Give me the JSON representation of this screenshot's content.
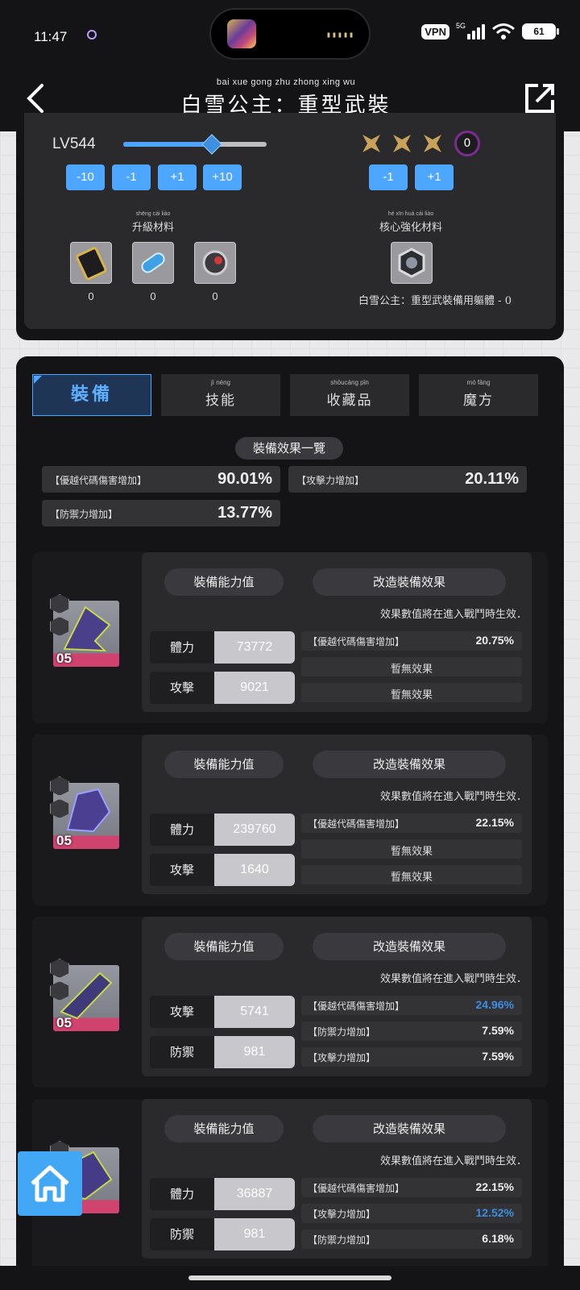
{
  "status": {
    "time": "11:47",
    "vpn": "VPN",
    "network": "5G",
    "battery": "61"
  },
  "header": {
    "title": "白雪公主：重型武裝",
    "ruby": "bai xue gong zhu      zhong xing wu"
  },
  "upgrade": {
    "level": "LV544",
    "level_fill": 0.62,
    "level_buttons": [
      "-10",
      "-1",
      "+1",
      "+10"
    ],
    "stars": 3,
    "star_count": "0",
    "core_buttons": [
      "-1",
      "+1"
    ],
    "materials_label": "升級材料",
    "materials_ruby": "shēng   cái  liào",
    "materials": [
      {
        "icon": "gold-battery-icon",
        "count": "0"
      },
      {
        "icon": "blue-capsule-icon",
        "count": "0"
      },
      {
        "icon": "red-core-orb-icon",
        "count": "0"
      }
    ],
    "core_label": "核心強化材料",
    "core_ruby": "hé  xīn     huà  cái  liào",
    "core_material": {
      "icon": "hexagon-module-icon"
    },
    "core_caption": "白雪公主：重型武裝備用軀體 - 0"
  },
  "tabs": [
    {
      "label": "裝備",
      "ruby": "",
      "active": true
    },
    {
      "label": "技能",
      "ruby": "jì  néng"
    },
    {
      "label": "收藏品",
      "ruby": "shōucáng pǐn"
    },
    {
      "label": "魔方",
      "ruby": "mó fāng"
    }
  ],
  "summary": {
    "title": "裝備效果一覽",
    "items": [
      {
        "label": "【優越代碼傷害增加】",
        "value": "90.01%"
      },
      {
        "label": "【攻擊力增加】",
        "value": "20.11%"
      },
      {
        "label": "【防禦力增加】",
        "value": "13.77%"
      }
    ]
  },
  "equipment_headers": {
    "ability": "裝備能力值",
    "effects": "改造裝備效果",
    "note": "效果數值將在進入戰鬥時生效．"
  },
  "equipment": [
    {
      "level": "05",
      "stats": [
        {
          "label": "體力",
          "value": "73772"
        },
        {
          "label": "攻擊",
          "value": "9021"
        }
      ],
      "effects": [
        {
          "label": "【優越代碼傷害增加】",
          "value": "20.75%",
          "highlight": false
        },
        {
          "none": "暫無效果"
        },
        {
          "none": "暫無效果"
        }
      ]
    },
    {
      "level": "05",
      "stats": [
        {
          "label": "體力",
          "value": "239760"
        },
        {
          "label": "攻擊",
          "value": "1640"
        }
      ],
      "effects": [
        {
          "label": "【優越代碼傷害增加】",
          "value": "22.15%",
          "highlight": false
        },
        {
          "none": "暫無效果"
        },
        {
          "none": "暫無效果"
        }
      ]
    },
    {
      "level": "05",
      "stats": [
        {
          "label": "攻擊",
          "value": "5741"
        },
        {
          "label": "防禦",
          "value": "981"
        }
      ],
      "effects": [
        {
          "label": "【優越代碼傷害增加】",
          "value": "24.96%",
          "highlight": true
        },
        {
          "label": "【防禦力增加】",
          "value": "7.59%",
          "highlight": false
        },
        {
          "label": "【攻擊力增加】",
          "value": "7.59%",
          "highlight": false
        }
      ]
    },
    {
      "level": "",
      "stats": [
        {
          "label": "體力",
          "value": "36887"
        },
        {
          "label": "防禦",
          "value": "981"
        }
      ],
      "effects": [
        {
          "label": "【優越代碼傷害增加】",
          "value": "22.15%",
          "highlight": false
        },
        {
          "label": "【攻擊力增加】",
          "value": "12.52%",
          "highlight": true
        },
        {
          "label": "【防禦力增加】",
          "value": "6.18%",
          "highlight": false
        }
      ]
    }
  ],
  "colors": {
    "accent": "#4da6ff",
    "highlight_value": "#3c8de6",
    "rank_badge": "#7a2d8f",
    "panel": "#2a2a2d"
  }
}
